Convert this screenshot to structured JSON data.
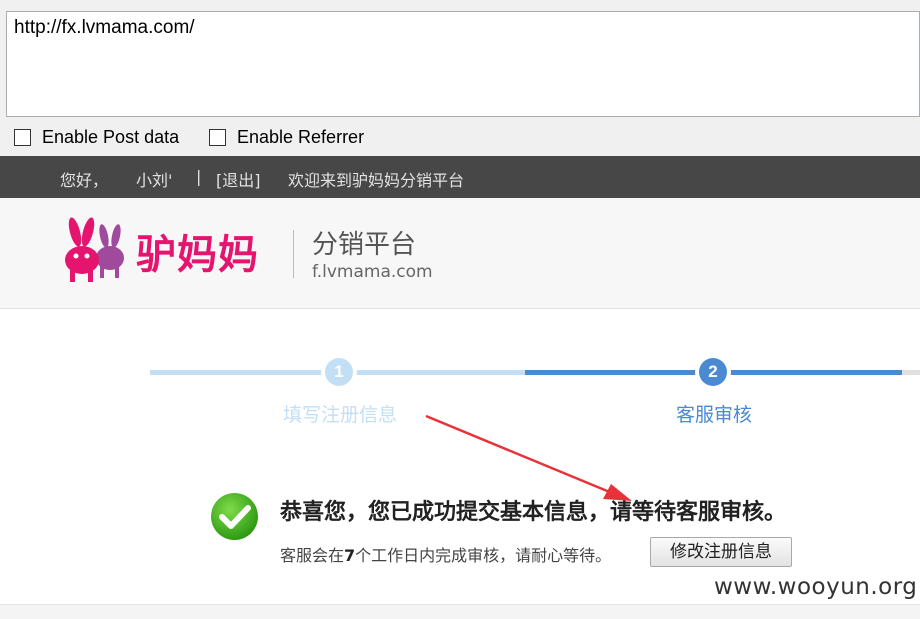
{
  "toolbar": {
    "url": "http://fx.lvmama.com/",
    "enable_post_label": "Enable Post data",
    "enable_referrer_label": "Enable Referrer"
  },
  "topbar": {
    "greeting": "您好，",
    "username": "小刘'",
    "separator": "|",
    "logout": "[退出]",
    "welcome": "欢迎来到驴妈妈分销平台"
  },
  "header": {
    "logo_text": "驴妈妈",
    "platform_title": "分销平台",
    "platform_domain": "f.lvmama.com"
  },
  "steps": [
    {
      "number": "1",
      "label": "填写注册信息",
      "state": "done"
    },
    {
      "number": "2",
      "label": "客服审核",
      "state": "current"
    }
  ],
  "success": {
    "title": "恭喜您，您已成功提交基本信息，请等待客服审核。",
    "desc_prefix": "客服会在",
    "desc_days": "7",
    "desc_suffix": "个工作日内完成审核，请耐心等待。",
    "modify_button": "修改注册信息"
  },
  "watermark": "www.wooyun.org",
  "colors": {
    "brand_pink": "#e4146f",
    "step_done": "#c3dff6",
    "step_current": "#4a8ad2",
    "arrow": "#e8323a"
  }
}
